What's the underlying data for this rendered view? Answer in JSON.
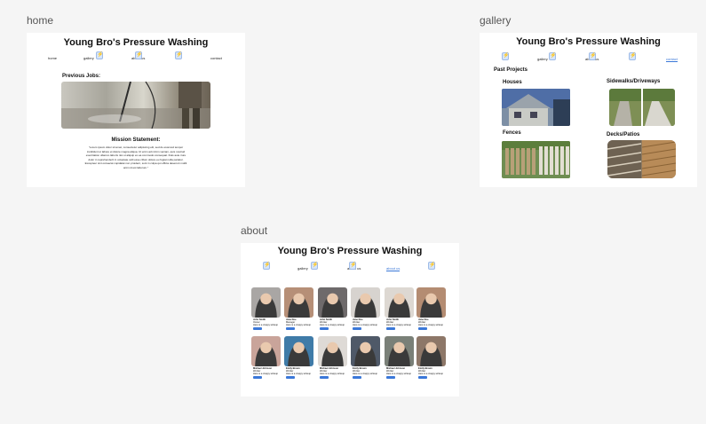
{
  "frames": {
    "home": {
      "label": "home"
    },
    "gallery": {
      "label": "gallery"
    },
    "about": {
      "label": "about"
    }
  },
  "site": {
    "title": "Young Bro's Pressure Washing"
  },
  "nav": {
    "home": "home",
    "gallery": "gallery",
    "about": "about us",
    "quote": "contact"
  },
  "home": {
    "previous_jobs": "Previous Jobs:",
    "mission_heading": "Mission Statement:",
    "mission_text": "\"Lorem ipsum dolor sit amet, consectetur adipiscing elit, sed do eiusmod tempor incididunt ut labore et dolore magna aliqua. Ut enim ad minim veniam, quis nostrud exercitation ullamco laboris nisi ut aliquip ex ea commodo consequat. Duis aute irure dolor in reprehenderit in voluptate velit esse cillum dolore eu fugiat nulla pariatur. Excepteur sint occaecat cupidatat non proident, sunt in culpa qui officia deserunt mollit anim id est laborum.\""
  },
  "gallery": {
    "heading": "Past Projects",
    "categories": [
      "Houses",
      "Sidewalks/Driveways",
      "Fences",
      "Decks/Patios"
    ]
  },
  "about": {
    "team": [
      {
        "name": "John Smith",
        "role": "Owner",
        "desc": "Here is a crappy writeup",
        "img": "#a9a6a4"
      },
      {
        "name": "Jane Doe",
        "role": "Manager",
        "desc": "Here is a crappy writeup",
        "img": "#b68f77"
      },
      {
        "name": "John Smith",
        "role": "Worker",
        "desc": "Here is a crappy writeup",
        "img": "#6e6a6b"
      },
      {
        "name": "Jane Doe",
        "role": "Worker",
        "desc": "Here is a crappy writeup",
        "img": "#d7d3cf"
      },
      {
        "name": "John Smith",
        "role": "Worker",
        "desc": "Here is a crappy writeup",
        "img": "#ddd8d2"
      },
      {
        "name": "Jane Doe",
        "role": "Worker",
        "desc": "Here is a crappy writeup",
        "img": "#b48c72"
      },
      {
        "name": "Michael Johnson",
        "role": "Worker",
        "desc": "Here is a crappy writeup",
        "img": "#c9a49a"
      },
      {
        "name": "Emily Brown",
        "role": "Worker",
        "desc": "Here is a crappy writeup",
        "img": "#3f7ba8"
      },
      {
        "name": "Michael Johnson",
        "role": "Worker",
        "desc": "Here is a crappy writeup",
        "img": "#dedad6"
      },
      {
        "name": "Emily Brown",
        "role": "Worker",
        "desc": "Here is a crappy writeup",
        "img": "#4f5968"
      },
      {
        "name": "Michael Johnson",
        "role": "Worker",
        "desc": "Here is a crappy writeup",
        "img": "#7a8078"
      },
      {
        "name": "Emily Brown",
        "role": "Worker",
        "desc": "Here is a crappy writeup",
        "img": "#8d7768"
      }
    ]
  },
  "colors": {
    "accent": "#3b78d8",
    "icon_bg": "#d5e5fb"
  },
  "icons": {
    "nav": "lightning-bolt-icon"
  }
}
